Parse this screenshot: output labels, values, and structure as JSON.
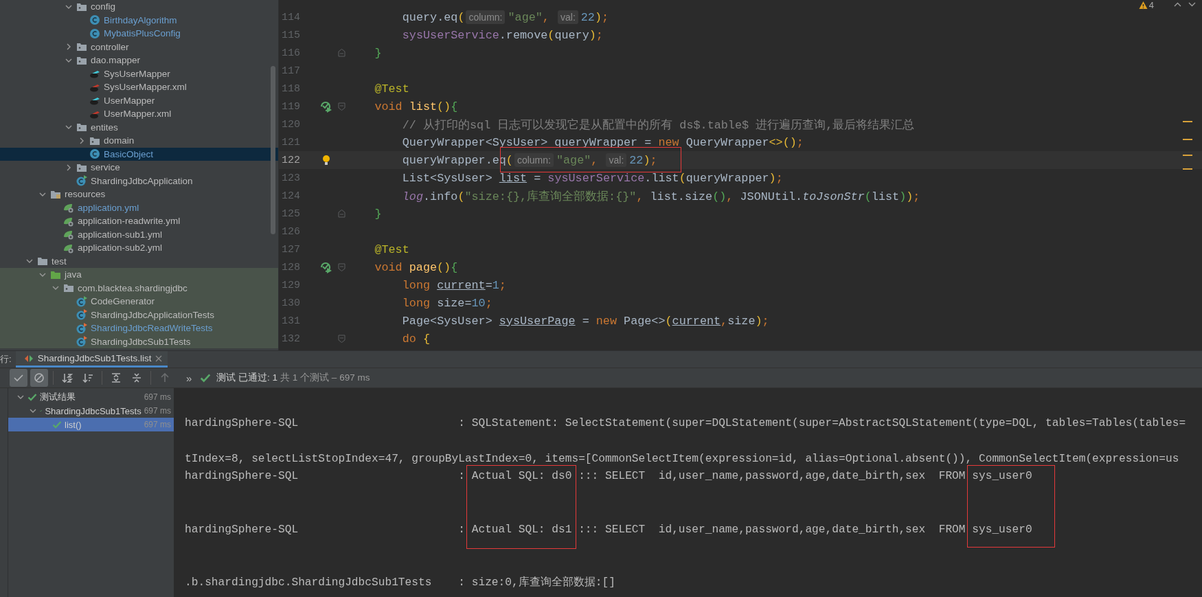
{
  "project_tree": [
    {
      "children": [
        {
          "children": [
            {
              "children": [
                {
                  "label": "config",
                  "kind": "folder",
                  "expanded": true,
                  "selected": false,
                  "modified": false,
                  "children": [
                    {
                      "label": "BirthdayAlgorithm",
                      "kind": "class",
                      "selected": false,
                      "modified": true
                    },
                    {
                      "label": "MybatisPlusConfig",
                      "kind": "class",
                      "selected": false,
                      "modified": true
                    }
                  ]
                },
                {
                  "label": "controller",
                  "kind": "folder",
                  "expanded": false,
                  "selected": false,
                  "modified": false
                },
                {
                  "label": "dao.mapper",
                  "kind": "folder",
                  "expanded": true,
                  "selected": false,
                  "modified": false,
                  "children": [
                    {
                      "label": "SysUserMapper",
                      "kind": "mapper",
                      "selected": false,
                      "modified": false
                    },
                    {
                      "label": "SysUserMapper.xml",
                      "kind": "mapper-xml",
                      "selected": false,
                      "modified": false
                    },
                    {
                      "label": "UserMapper",
                      "kind": "mapper",
                      "selected": false,
                      "modified": false
                    },
                    {
                      "label": "UserMapper.xml",
                      "kind": "mapper-xml",
                      "selected": false,
                      "modified": false
                    }
                  ]
                },
                {
                  "label": "entites",
                  "kind": "folder",
                  "expanded": true,
                  "selected": false,
                  "modified": false,
                  "children": [
                    {
                      "label": "domain",
                      "kind": "folder",
                      "expanded": false,
                      "selected": false,
                      "modified": false
                    },
                    {
                      "label": "BasicObject",
                      "kind": "class",
                      "selected": true,
                      "modified": true
                    }
                  ]
                },
                {
                  "label": "service",
                  "kind": "folder",
                  "expanded": false,
                  "selected": false,
                  "modified": false
                },
                {
                  "label": "ShardingJdbcApplication",
                  "kind": "app",
                  "selected": false,
                  "modified": false
                }
              ]
            }
          ]
        },
        {
          "label": "resources",
          "kind": "resources",
          "expanded": true,
          "selected": false,
          "modified": false,
          "children": [
            {
              "label": "application.yml",
              "kind": "yml",
              "selected": false,
              "modified": true
            },
            {
              "label": "application-readwrite.yml",
              "kind": "yml",
              "selected": false,
              "modified": false
            },
            {
              "label": "application-sub1.yml",
              "kind": "yml",
              "selected": false,
              "modified": false
            },
            {
              "label": "application-sub2.yml",
              "kind": "yml",
              "selected": false,
              "modified": false
            }
          ]
        }
      ]
    },
    {
      "label": "test",
      "kind": "plain-folder",
      "expanded": true,
      "selected": false,
      "modified": false,
      "children": [
        {
          "label": "java",
          "kind": "test-sources",
          "expanded": true,
          "selected": false,
          "modified": false,
          "children": [
            {
              "label": "com.blacktea.shardingjdbc",
              "kind": "folder",
              "expanded": true,
              "selected": false,
              "modified": false,
              "children": [
                {
                  "label": "CodeGenerator",
                  "kind": "app",
                  "selected": false,
                  "modified": false
                },
                {
                  "label": "ShardingJdbcApplicationTests",
                  "kind": "test-class",
                  "selected": false,
                  "modified": false
                },
                {
                  "label": "ShardingJdbcReadWriteTests",
                  "kind": "test-class",
                  "selected": false,
                  "modified": true
                },
                {
                  "label": "ShardingJdbcSub1Tests",
                  "kind": "test-class",
                  "selected": false,
                  "modified": false
                }
              ]
            }
          ]
        }
      ]
    }
  ],
  "editor": {
    "warnings": "4",
    "lines": [
      {
        "number": "114",
        "kind": "body",
        "current": false,
        "tokens": [
          {
            "kind": "plain",
            "t": "query.eq"
          },
          {
            "kind": "br",
            "t": "("
          },
          {
            "kind": "hint",
            "t": "column:"
          },
          {
            "kind": "str",
            "t": "\"age\""
          },
          {
            "kind": "kw",
            "t": ", "
          },
          {
            "kind": "hint",
            "t": "val:"
          },
          {
            "kind": "num",
            "t": "22"
          },
          {
            "kind": "br",
            "t": ")"
          },
          {
            "kind": "kw",
            "t": ";"
          }
        ]
      },
      {
        "number": "115",
        "kind": "body",
        "current": false,
        "tokens": [
          {
            "kind": "field",
            "t": "sysUserService"
          },
          {
            "kind": "plain",
            "t": ".remove"
          },
          {
            "kind": "br",
            "t": "("
          },
          {
            "kind": "plain",
            "t": "query"
          },
          {
            "kind": "br",
            "t": ")"
          },
          {
            "kind": "kw",
            "t": ";"
          }
        ]
      },
      {
        "number": "116",
        "kind": "member",
        "current": false,
        "fold": {
          "kind": "end"
        },
        "tokens": [
          {
            "kind": "br2",
            "t": "}"
          }
        ]
      },
      {
        "number": "117",
        "kind": "blank",
        "current": false
      },
      {
        "number": "118",
        "kind": "member",
        "current": false,
        "tokens": [
          {
            "kind": "ann",
            "t": "@Test"
          }
        ]
      },
      {
        "number": "119",
        "kind": "member",
        "current": false,
        "gutter": {
          "kind": "run"
        },
        "fold": {
          "kind": "start"
        },
        "tokens": [
          {
            "kind": "kw",
            "t": "void "
          },
          {
            "kind": "fn",
            "t": "list"
          },
          {
            "kind": "br",
            "t": "()"
          },
          {
            "kind": "br2",
            "t": "{"
          }
        ]
      },
      {
        "number": "120",
        "kind": "body",
        "current": false,
        "tokens": [
          {
            "kind": "cmt",
            "t": "// 从打印的sql 日志可以发现它是从配置中的所有 ds$.table$ 进行遍历查询,最后将结果汇总"
          }
        ]
      },
      {
        "number": "121",
        "kind": "body",
        "current": false,
        "tokens": [
          {
            "kind": "plain",
            "t": "QueryWrapper<SysUser> queryWrapper = "
          },
          {
            "kind": "kw",
            "t": "new"
          },
          {
            "kind": "plain",
            "t": " QueryWrapper"
          },
          {
            "kind": "br",
            "t": "<>()"
          },
          {
            "kind": "kw",
            "t": ";"
          }
        ]
      },
      {
        "number": "122",
        "kind": "body",
        "current": true,
        "gutter": {
          "kind": "bulb"
        },
        "tokens": [
          {
            "kind": "plain",
            "t": "queryWrapper.eq"
          },
          {
            "kind": "br",
            "t": "("
          },
          {
            "kind": "hint",
            "t": "column:"
          },
          {
            "kind": "str",
            "t": "\"age\""
          },
          {
            "kind": "kw",
            "t": ", "
          },
          {
            "kind": "hint",
            "t": "val:"
          },
          {
            "kind": "num",
            "t": "22"
          },
          {
            "kind": "br",
            "t": ")"
          },
          {
            "kind": "kw",
            "t": ";"
          }
        ]
      },
      {
        "number": "123",
        "kind": "body",
        "current": false,
        "tokens": [
          {
            "kind": "plain",
            "t": "List<SysUser> "
          },
          {
            "kind": "var",
            "t": "list"
          },
          {
            "kind": "plain",
            "t": " = "
          },
          {
            "kind": "field",
            "t": "sysUserService"
          },
          {
            "kind": "plain",
            "t": ".list"
          },
          {
            "kind": "br",
            "t": "("
          },
          {
            "kind": "plain",
            "t": "queryWrapper"
          },
          {
            "kind": "br",
            "t": ")"
          },
          {
            "kind": "kw",
            "t": ";"
          }
        ]
      },
      {
        "number": "124",
        "kind": "body",
        "current": false,
        "tokens": [
          {
            "kind": "static-field",
            "t": "log"
          },
          {
            "kind": "plain",
            "t": ".info"
          },
          {
            "kind": "br",
            "t": "("
          },
          {
            "kind": "str",
            "t": "\"size:{},库查询全部数据:{}\""
          },
          {
            "kind": "kw",
            "t": ", "
          },
          {
            "kind": "plain",
            "t": "list.size"
          },
          {
            "kind": "br2",
            "t": "()"
          },
          {
            "kind": "kw",
            "t": ", "
          },
          {
            "kind": "plain",
            "t": "JSONUtil."
          },
          {
            "kind": "static-method",
            "t": "toJsonStr"
          },
          {
            "kind": "br2",
            "t": "("
          },
          {
            "kind": "plain",
            "t": "list"
          },
          {
            "kind": "br2",
            "t": ")"
          },
          {
            "kind": "br",
            "t": ")"
          },
          {
            "kind": "kw",
            "t": ";"
          }
        ]
      },
      {
        "number": "125",
        "kind": "member",
        "current": false,
        "fold": {
          "kind": "end"
        },
        "tokens": [
          {
            "kind": "br2",
            "t": "}"
          }
        ]
      },
      {
        "number": "126",
        "kind": "blank",
        "current": false
      },
      {
        "number": "127",
        "kind": "member",
        "current": false,
        "tokens": [
          {
            "kind": "ann",
            "t": "@Test"
          }
        ]
      },
      {
        "number": "128",
        "kind": "member",
        "current": false,
        "gutter": {
          "kind": "run"
        },
        "fold": {
          "kind": "start"
        },
        "tokens": [
          {
            "kind": "kw",
            "t": "void "
          },
          {
            "kind": "fn",
            "t": "page"
          },
          {
            "kind": "br",
            "t": "()"
          },
          {
            "kind": "br2",
            "t": "{"
          }
        ]
      },
      {
        "number": "129",
        "kind": "body",
        "current": false,
        "tokens": [
          {
            "kind": "kw",
            "t": "long "
          },
          {
            "kind": "var",
            "t": "current"
          },
          {
            "kind": "plain",
            "t": "="
          },
          {
            "kind": "num",
            "t": "1"
          },
          {
            "kind": "kw",
            "t": ";"
          }
        ]
      },
      {
        "number": "130",
        "kind": "body",
        "current": false,
        "tokens": [
          {
            "kind": "kw",
            "t": "long "
          },
          {
            "kind": "plain",
            "t": "size="
          },
          {
            "kind": "num",
            "t": "10"
          },
          {
            "kind": "kw",
            "t": ";"
          }
        ]
      },
      {
        "number": "131",
        "kind": "body",
        "current": false,
        "tokens": [
          {
            "kind": "plain",
            "t": "Page<SysUser> "
          },
          {
            "kind": "var",
            "t": "sysUserPage"
          },
          {
            "kind": "plain",
            "t": " = "
          },
          {
            "kind": "kw",
            "t": "new"
          },
          {
            "kind": "plain",
            "t": " Page<>"
          },
          {
            "kind": "br",
            "t": "("
          },
          {
            "kind": "var",
            "t": "current"
          },
          {
            "kind": "kw",
            "t": ","
          },
          {
            "kind": "plain",
            "t": "size"
          },
          {
            "kind": "br",
            "t": ")"
          },
          {
            "kind": "kw",
            "t": ";"
          }
        ]
      },
      {
        "number": "132",
        "kind": "body",
        "current": false,
        "fold": {
          "kind": "start"
        },
        "tokens": [
          {
            "kind": "kw",
            "t": "do "
          },
          {
            "kind": "br",
            "t": "{"
          }
        ]
      }
    ]
  },
  "run_panel": {
    "label": "行:",
    "tabs": [
      {
        "label": "ShardingJdbcSub1Tests.list",
        "selected": true
      }
    ],
    "toolbar": [
      {
        "kind": "show-passed",
        "on": true,
        "disabled": false
      },
      {
        "kind": "show-ignored",
        "on": true,
        "disabled": false
      },
      {
        "kind": "sort-alpha",
        "on": false,
        "disabled": false
      },
      {
        "kind": "sort-duration",
        "on": false,
        "disabled": false
      },
      {
        "kind": "expand-all",
        "on": false,
        "disabled": false
      },
      {
        "kind": "collapse-all",
        "on": false,
        "disabled": false
      },
      {
        "kind": "previous",
        "on": false,
        "disabled": true
      }
    ],
    "more": "»",
    "status": "测试 已通过: 1",
    "status_detail": "共 1 个测试 – 697 ms",
    "tests": [
      {
        "label": "测试结果",
        "duration": "697 ms",
        "passed": true,
        "expanded": true,
        "selected": false,
        "children": [
          {
            "label": "ShardingJdbcSub1Tests",
            "duration": "697 ms",
            "passed": true,
            "expanded": true,
            "selected": false,
            "children": [
              {
                "label": "list()",
                "duration": "697 ms",
                "passed": true,
                "selected": true
              }
            ]
          }
        ]
      }
    ],
    "console": [
      {
        "text": "hardingSphere-SQL                        : SQLStatement: SelectStatement(super=DQLStatement(super=AbstractSQLStatement(type=DQL, tables=Tables(tables="
      },
      {
        "text": "tIndex=8, selectListStopIndex=47, groupByLastIndex=0, items=[CommonSelectItem(expression=id, alias=Optional.absent()), CommonSelectItem(expression=us"
      },
      {
        "text": "hardingSphere-SQL                        : Actual SQL: ds0 ::: SELECT  id,user_name,password,age,date_birth,sex  FROM sys_user0"
      },
      {
        "text": "hardingSphere-SQL                        : Actual SQL: ds1 ::: SELECT  id,user_name,password,age,date_birth,sex  FROM sys_user0"
      },
      {
        "text": ".b.shardingjdbc.ShardingJdbcSub1Tests    : size:0,库查询全部数据:[]"
      }
    ]
  }
}
